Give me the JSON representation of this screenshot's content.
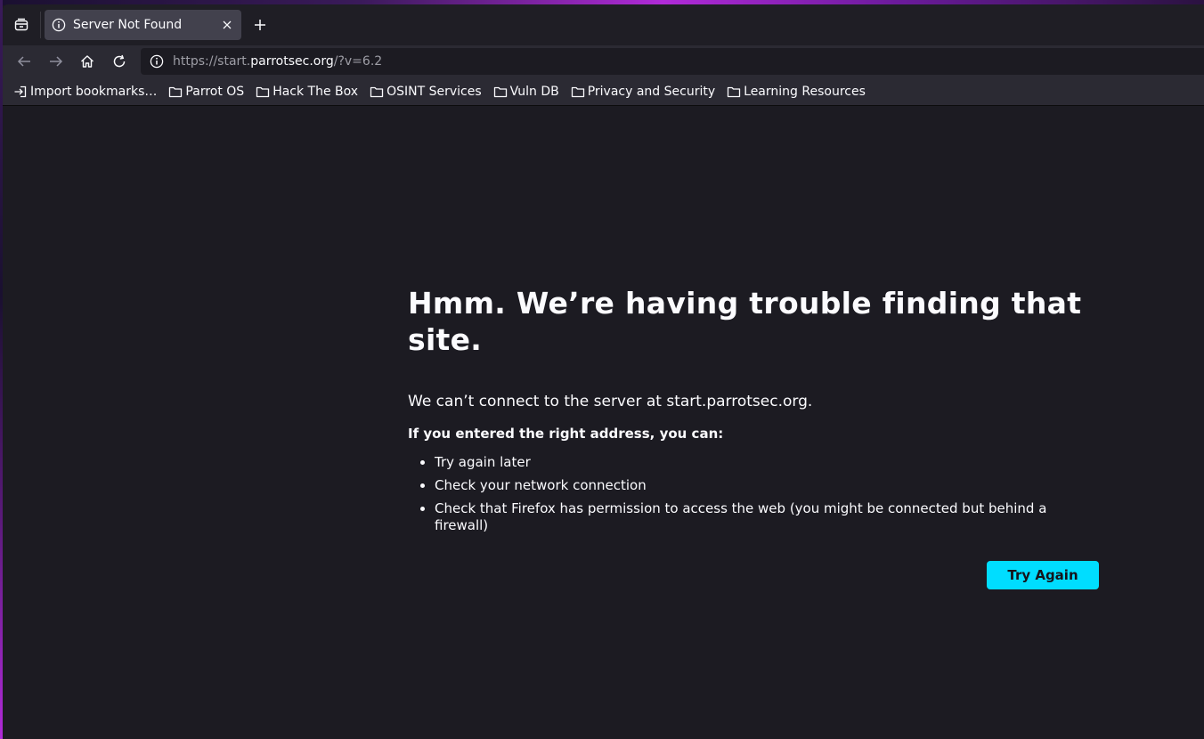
{
  "tab": {
    "title": "Server Not Found",
    "icon": "info-icon"
  },
  "nav": {
    "url_scheme": "https://start.",
    "url_host": "parrotsec.org",
    "url_rest": "/?v=6.2"
  },
  "bookmarks": [
    {
      "label": "Import bookmarks…",
      "icon": "import-icon"
    },
    {
      "label": "Parrot OS",
      "icon": "folder-icon"
    },
    {
      "label": "Hack The Box",
      "icon": "folder-icon"
    },
    {
      "label": "OSINT Services",
      "icon": "folder-icon"
    },
    {
      "label": "Vuln DB",
      "icon": "folder-icon"
    },
    {
      "label": "Privacy and Security",
      "icon": "folder-icon"
    },
    {
      "label": "Learning Resources",
      "icon": "folder-icon"
    }
  ],
  "error": {
    "title": "Hmm. We’re having trouble finding that site.",
    "description": "We can’t connect to the server at start.parrotsec.org.",
    "subheading": "If you entered the right address, you can:",
    "suggestions": [
      "Try again later",
      "Check your network connection",
      "Check that Firefox has permission to access the web (you might be connected but behind a firewall)"
    ],
    "button": "Try Again"
  },
  "colors": {
    "accent": "#00ddff",
    "background": "#1c1b22",
    "toolbar": "#2b2a33",
    "tab_selected": "#42414d"
  }
}
